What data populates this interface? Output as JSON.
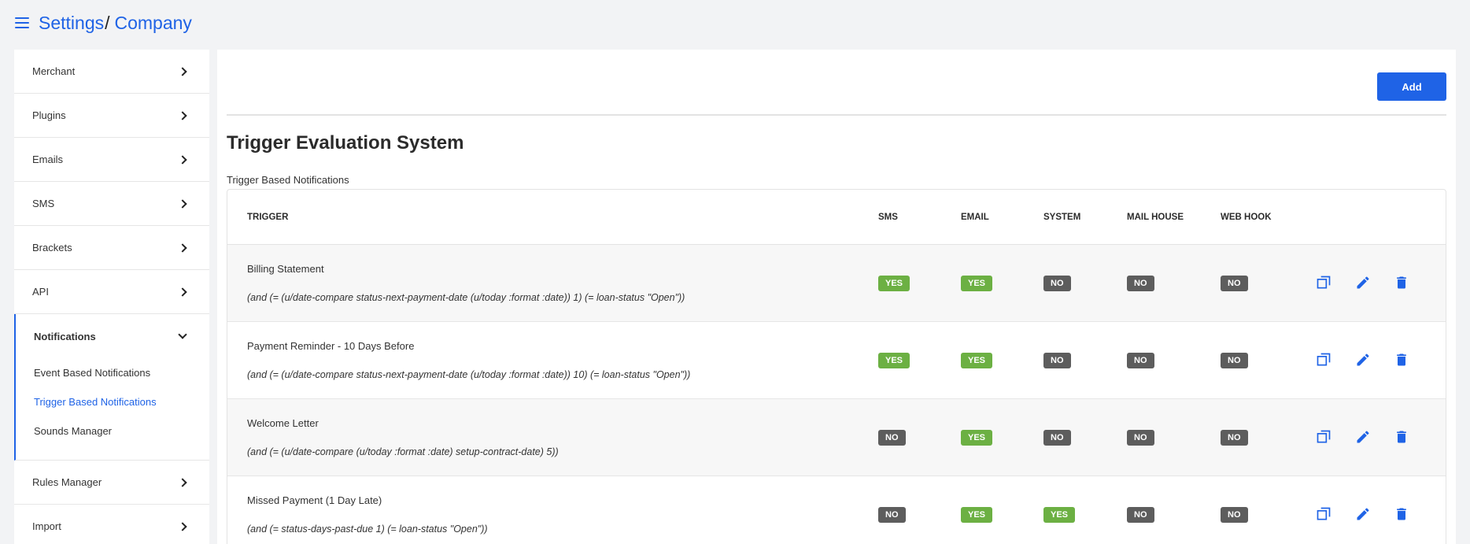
{
  "breadcrumb": {
    "root": "Settings",
    "separator": "/",
    "current": "Company"
  },
  "sidebar": {
    "items_top": [
      {
        "label": "Merchant"
      },
      {
        "label": "Plugins"
      },
      {
        "label": "Emails"
      },
      {
        "label": "SMS"
      },
      {
        "label": "Brackets"
      },
      {
        "label": "API"
      }
    ],
    "group": {
      "label": "Notifications",
      "subitems": [
        {
          "label": "Event Based Notifications"
        },
        {
          "label": "Trigger Based Notifications"
        },
        {
          "label": "Sounds Manager"
        }
      ]
    },
    "items_bottom": [
      {
        "label": "Rules Manager"
      },
      {
        "label": "Import"
      }
    ]
  },
  "main": {
    "add_label": "Add",
    "title": "Trigger Evaluation System",
    "subtitle": "Trigger Based Notifications",
    "columns": {
      "trigger": "TRIGGER",
      "sms": "SMS",
      "email": "EMAIL",
      "system": "SYSTEM",
      "mail_house": "MAIL HOUSE",
      "web_hook": "WEB HOOK"
    },
    "rows": [
      {
        "name": "Billing Statement",
        "expr": "(and (= (u/date-compare status-next-payment-date (u/today :format :date)) 1) (= loan-status \"Open\"))",
        "sms": "YES",
        "email": "YES",
        "system": "NO",
        "mail_house": "NO",
        "web_hook": "NO"
      },
      {
        "name": "Payment Reminder - 10 Days Before",
        "expr": "(and (= (u/date-compare status-next-payment-date (u/today :format :date)) 10) (= loan-status \"Open\"))",
        "sms": "YES",
        "email": "YES",
        "system": "NO",
        "mail_house": "NO",
        "web_hook": "NO"
      },
      {
        "name": "Welcome Letter",
        "expr": "(and (= (u/date-compare (u/today :format :date) setup-contract-date) 5))",
        "sms": "NO",
        "email": "YES",
        "system": "NO",
        "mail_house": "NO",
        "web_hook": "NO"
      },
      {
        "name": "Missed Payment (1 Day Late)",
        "expr": "(and (= status-days-past-due 1) (= loan-status \"Open\"))",
        "sms": "NO",
        "email": "YES",
        "system": "YES",
        "mail_house": "NO",
        "web_hook": "NO"
      }
    ]
  },
  "colors": {
    "accent": "#1f63e6",
    "yes": "#6cb043",
    "no": "#5d5d5d"
  },
  "icons": {
    "menu": "hamburger-icon",
    "copy": "copy-icon",
    "edit": "pencil-icon",
    "delete": "trash-icon",
    "chevron": "chevron-right-icon"
  }
}
